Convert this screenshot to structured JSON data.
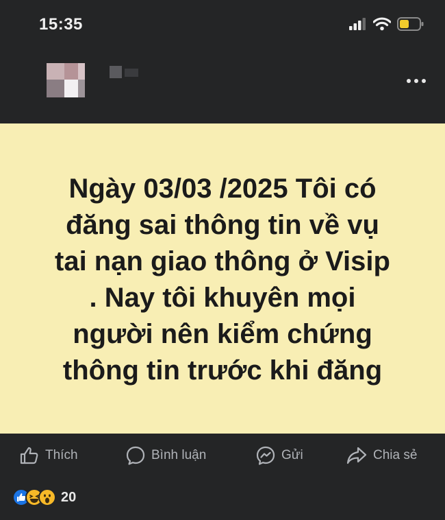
{
  "status_bar": {
    "time": "15:35"
  },
  "post": {
    "lines": [
      "Ngày 03/03 /2025 Tôi có",
      "đăng sai thông tin về vụ",
      "tai nạn giao thông ở Visip",
      ". Nay tôi khuyên mọi",
      "người nên kiểm chứng",
      "thông tin trước khi đăng"
    ],
    "background_color": "#f8eeb4"
  },
  "actions": {
    "like_label": "Thích",
    "comment_label": "Bình luận",
    "send_label": "Gửi",
    "share_label": "Chia sẻ"
  },
  "reactions": {
    "icons": [
      "like-icon",
      "haha-icon",
      "wow-icon"
    ],
    "count": "20"
  }
}
